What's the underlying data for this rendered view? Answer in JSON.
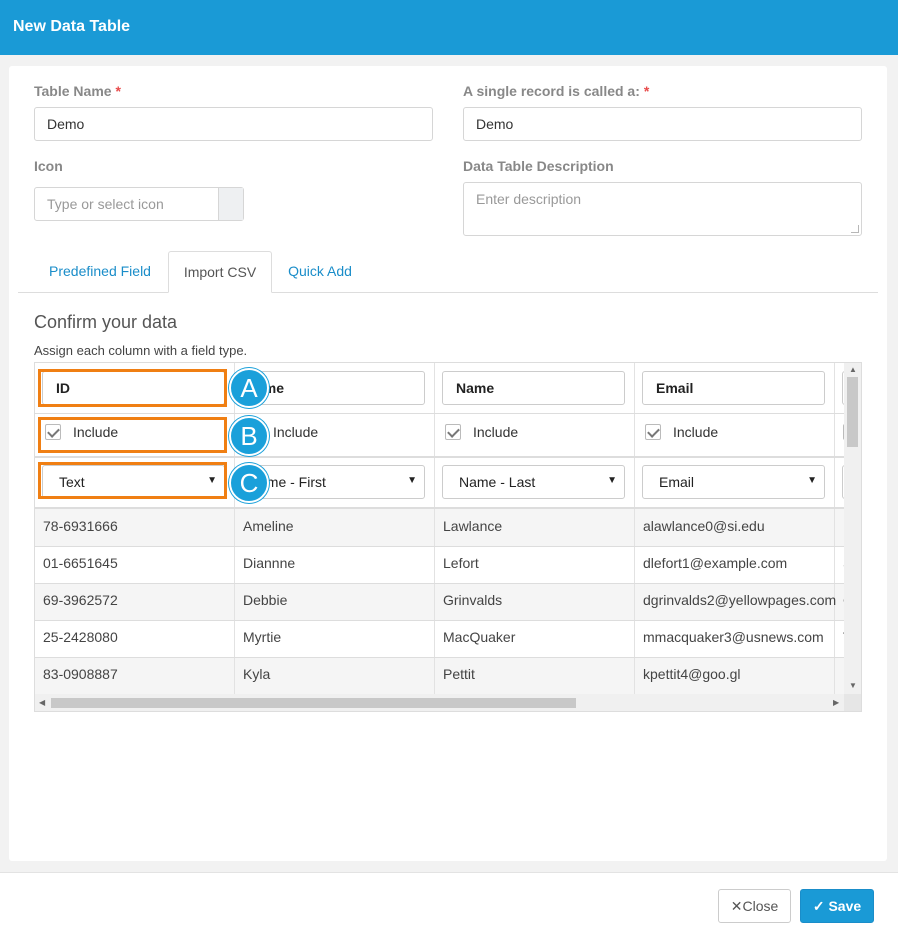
{
  "window": {
    "title": "New Data Table"
  },
  "form": {
    "table_name_label": "Table Name",
    "table_name_required": "*",
    "table_name_value": "Demo",
    "record_label": "A single record is called a:",
    "record_required": "*",
    "record_value": "Demo",
    "icon_label": "Icon",
    "icon_placeholder": "Type or select icon",
    "description_label": "Data Table Description",
    "description_placeholder": "Enter description"
  },
  "tabs": [
    {
      "label": "Predefined Field"
    },
    {
      "label": "Import CSV"
    },
    {
      "label": "Quick Add"
    }
  ],
  "confirm": {
    "heading": "Confirm your data",
    "instructions": "Assign each column with a field type."
  },
  "grid": {
    "columns": [
      {
        "header": "ID",
        "include_label": "Include",
        "type": "Text"
      },
      {
        "header": "ame",
        "include_label": "Include",
        "type": "ame - First"
      },
      {
        "header": "Name",
        "include_label": "Include",
        "type": "Name - Last"
      },
      {
        "header": "Email",
        "include_label": "Include",
        "type": "Email"
      }
    ],
    "rows": [
      [
        "78-6931666",
        "Ameline",
        "Lawlance",
        "alawlance0@si.edu"
      ],
      [
        "01-6651645",
        "Diannne",
        "Lefort",
        "dlefort1@example.com"
      ],
      [
        "69-3962572",
        "Debbie",
        "Grinvalds",
        "dgrinvalds2@yellowpages.com"
      ],
      [
        "25-2428080",
        "Myrtie",
        "MacQuaker",
        "mmacquaker3@usnews.com"
      ],
      [
        "83-0908887",
        "Kyla",
        "Pettit",
        "kpettit4@goo.gl"
      ]
    ],
    "partial_col_cells": [
      "I",
      "S",
      "C",
      "T",
      "I"
    ]
  },
  "callouts": {
    "a": "A",
    "b": "B",
    "c": "C"
  },
  "footer": {
    "close_label": "Close",
    "save_label": "Save"
  },
  "colors": {
    "header_bg": "#1a9ad6",
    "highlight": "#f07f13",
    "link": "#1a8dc9"
  }
}
